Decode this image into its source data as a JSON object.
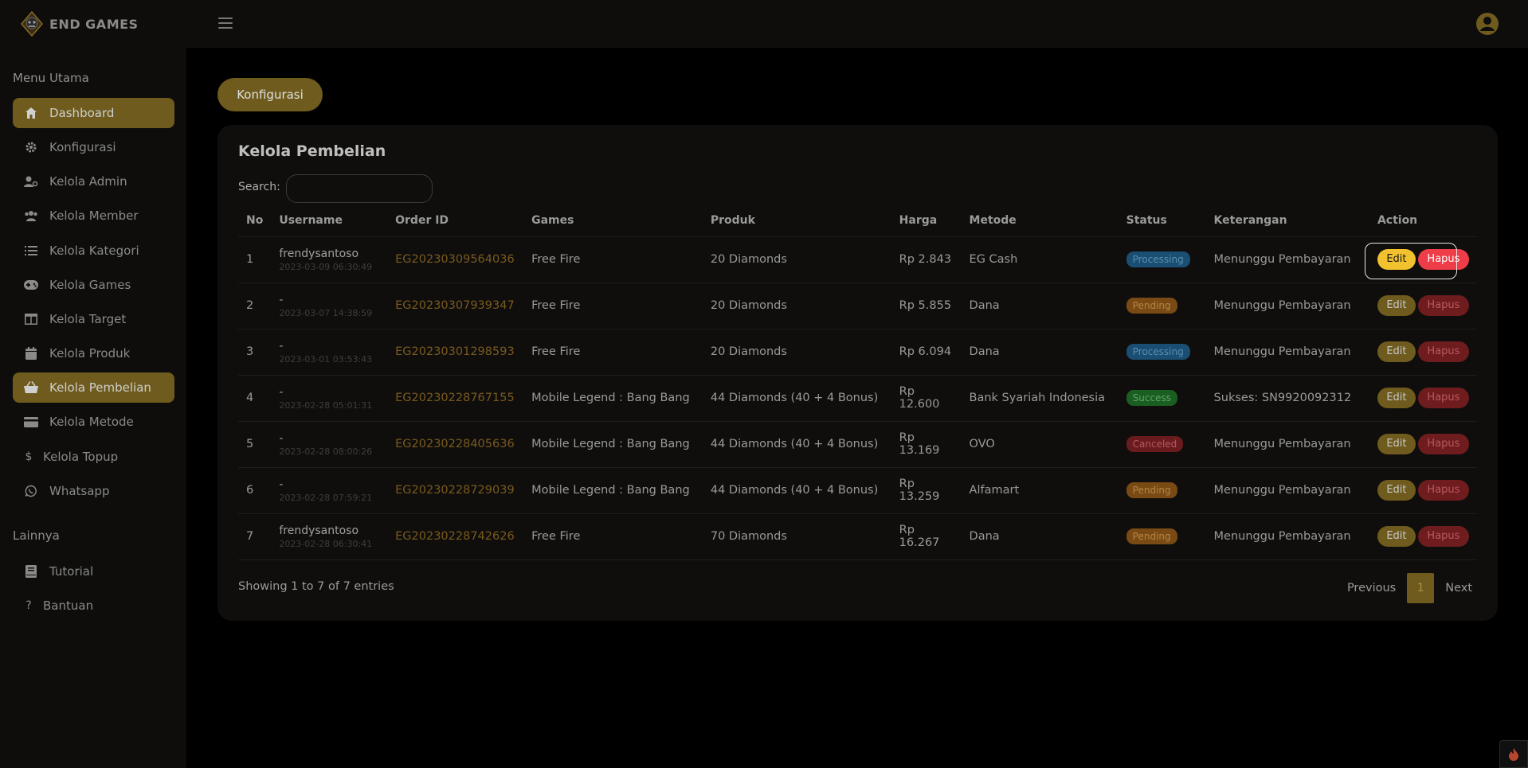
{
  "brand": {
    "name": "END GAMES"
  },
  "sidebar": {
    "main_title": "Menu Utama",
    "other_title": "Lainnya",
    "main_items": [
      {
        "label": "Dashboard",
        "icon": "home-icon",
        "active": true
      },
      {
        "label": "Konfigurasi",
        "icon": "gear-icon",
        "active": false
      },
      {
        "label": "Kelola Admin",
        "icon": "user-cog-icon",
        "active": false
      },
      {
        "label": "Kelola Member",
        "icon": "users-icon",
        "active": false
      },
      {
        "label": "Kelola Kategori",
        "icon": "list-icon",
        "active": false
      },
      {
        "label": "Kelola Games",
        "icon": "gamepad-icon",
        "active": false
      },
      {
        "label": "Kelola Target",
        "icon": "columns-icon",
        "active": false
      },
      {
        "label": "Kelola Produk",
        "icon": "calendar-icon",
        "active": false
      },
      {
        "label": "Kelola Pembelian",
        "icon": "basket-icon",
        "active": true
      },
      {
        "label": "Kelola Metode",
        "icon": "card-icon",
        "active": false
      },
      {
        "label": "Kelola Topup",
        "icon": "dollar-icon",
        "active": false
      },
      {
        "label": "Whatsapp",
        "icon": "whatsapp-icon",
        "active": false
      }
    ],
    "other_items": [
      {
        "label": "Tutorial",
        "icon": "book-icon"
      },
      {
        "label": "Bantuan",
        "icon": "question-icon"
      }
    ]
  },
  "main": {
    "config_button": "Konfigurasi",
    "card_title": "Kelola Pembelian",
    "search_label": "Search:",
    "search_value": "",
    "columns": [
      "No",
      "Username",
      "Order ID",
      "Games",
      "Produk",
      "Harga",
      "Metode",
      "Status",
      "Keterangan",
      "Action"
    ],
    "rows": [
      {
        "no": "1",
        "username": "frendysantoso",
        "date": "2023-03-09 06:30:49",
        "order_id": "EG20230309564036",
        "game": "Free Fire",
        "product": "20 Diamonds",
        "price": "Rp 2.843",
        "method": "EG Cash",
        "status": "Processing",
        "note": "Menunggu Pembayaran"
      },
      {
        "no": "2",
        "username": "-",
        "date": "2023-03-07 14:38:59",
        "order_id": "EG20230307939347",
        "game": "Free Fire",
        "product": "20 Diamonds",
        "price": "Rp 5.855",
        "method": "Dana",
        "status": "Pending",
        "note": "Menunggu Pembayaran"
      },
      {
        "no": "3",
        "username": "-",
        "date": "2023-03-01 03:53:43",
        "order_id": "EG20230301298593",
        "game": "Free Fire",
        "product": "20 Diamonds",
        "price": "Rp 6.094",
        "method": "Dana",
        "status": "Processing",
        "note": "Menunggu Pembayaran"
      },
      {
        "no": "4",
        "username": "-",
        "date": "2023-02-28 05:01:31",
        "order_id": "EG20230228767155",
        "game": "Mobile Legend : Bang Bang",
        "product": "44 Diamonds (40 + 4 Bonus)",
        "price": "Rp 12.600",
        "method": "Bank Syariah Indonesia",
        "status": "Success",
        "note": "Sukses: SN9920092312"
      },
      {
        "no": "5",
        "username": "-",
        "date": "2023-02-28 08:00:26",
        "order_id": "EG20230228405636",
        "game": "Mobile Legend : Bang Bang",
        "product": "44 Diamonds (40 + 4 Bonus)",
        "price": "Rp 13.169",
        "method": "OVO",
        "status": "Canceled",
        "note": "Menunggu Pembayaran"
      },
      {
        "no": "6",
        "username": "-",
        "date": "2023-02-28 07:59:21",
        "order_id": "EG20230228729039",
        "game": "Mobile Legend : Bang Bang",
        "product": "44 Diamonds (40 + 4 Bonus)",
        "price": "Rp 13.259",
        "method": "Alfamart",
        "status": "Pending",
        "note": "Menunggu Pembayaran"
      },
      {
        "no": "7",
        "username": "frendysantoso",
        "date": "2023-02-28 06:30:41",
        "order_id": "EG20230228742626",
        "game": "Free Fire",
        "product": "70 Diamonds",
        "price": "Rp 16.267",
        "method": "Dana",
        "status": "Pending",
        "note": "Menunggu Pembayaran"
      }
    ],
    "edit_label": "Edit",
    "delete_label": "Hapus",
    "showing_text": "Showing 1 to 7 of 7 entries",
    "pagination": {
      "previous": "Previous",
      "current": "1",
      "next": "Next"
    }
  },
  "colors": {
    "accent": "#6e5b1d",
    "accent_bright": "#f2c12e",
    "danger": "#ee3d48",
    "background": "#000000",
    "panel": "#0e0d0c"
  }
}
